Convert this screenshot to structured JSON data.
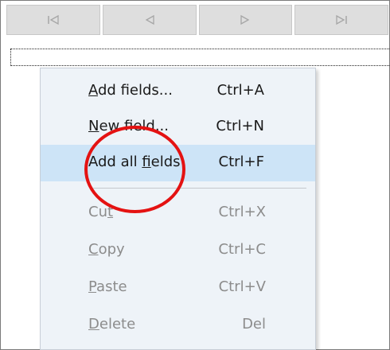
{
  "navigation": {
    "buttons": [
      {
        "icon": "first-record-icon"
      },
      {
        "icon": "previous-record-icon"
      },
      {
        "icon": "next-record-icon"
      },
      {
        "icon": "last-record-icon"
      }
    ]
  },
  "context_menu": {
    "items": [
      {
        "label_pre": "",
        "accel": "A",
        "label_post": "dd fields...",
        "shortcut": "Ctrl+A",
        "enabled": true,
        "highlighted": false
      },
      {
        "label_pre": "",
        "accel": "N",
        "label_post": "ew field...",
        "shortcut": "Ctrl+N",
        "enabled": true,
        "highlighted": false
      },
      {
        "label_pre": "Add all ",
        "accel": "f",
        "label_post": "ields",
        "shortcut": "Ctrl+F",
        "enabled": true,
        "highlighted": true
      },
      {
        "label_pre": "Cu",
        "accel": "t",
        "label_post": "",
        "shortcut": "Ctrl+X",
        "enabled": false,
        "highlighted": false
      },
      {
        "label_pre": "",
        "accel": "C",
        "label_post": "opy",
        "shortcut": "Ctrl+C",
        "enabled": false,
        "highlighted": false
      },
      {
        "label_pre": "",
        "accel": "P",
        "label_post": "aste",
        "shortcut": "Ctrl+V",
        "enabled": false,
        "highlighted": false
      },
      {
        "label_pre": "",
        "accel": "D",
        "label_post": "elete",
        "shortcut": "Del",
        "enabled": false,
        "highlighted": false
      }
    ]
  },
  "colors": {
    "highlight": "#cde4f7",
    "annotation_circle": "#e41212",
    "menu_background": "#eef3f8"
  }
}
